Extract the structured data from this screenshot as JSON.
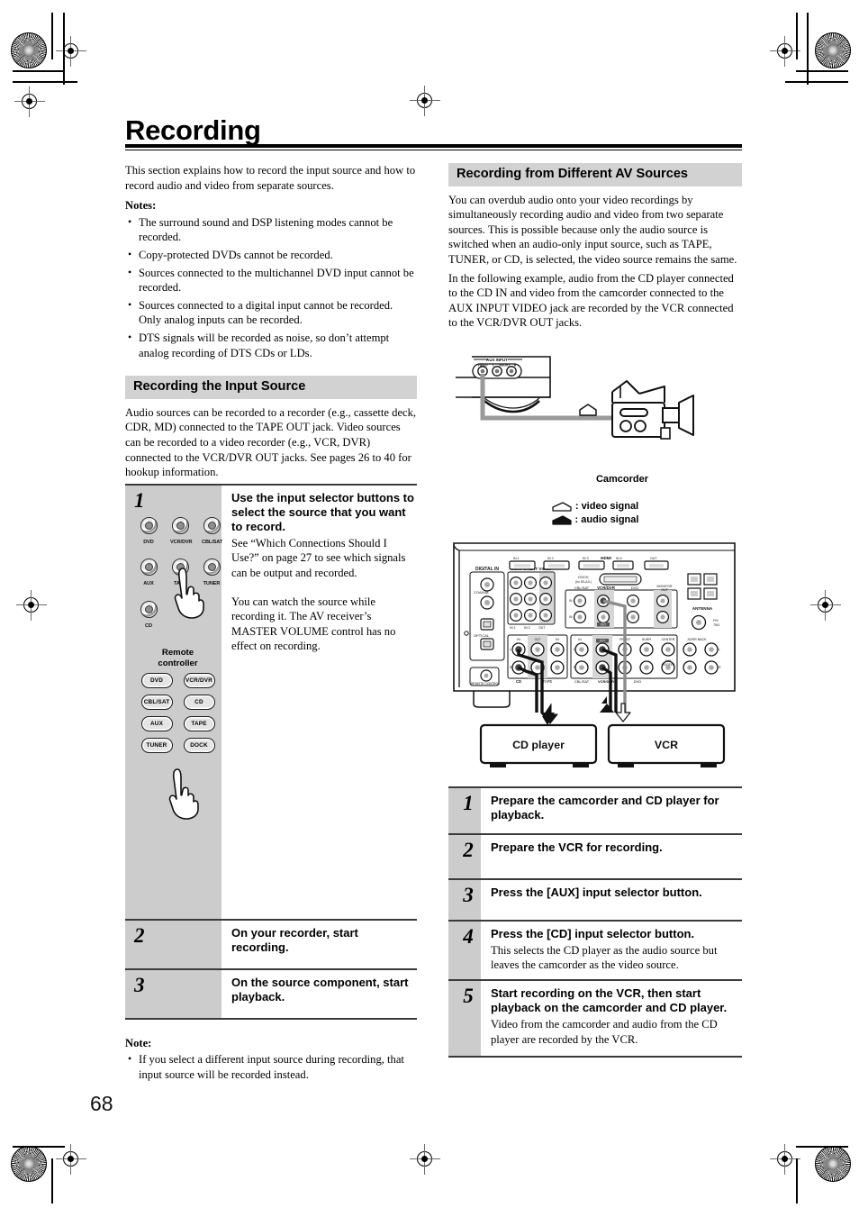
{
  "page": {
    "number": "68",
    "title": "Recording"
  },
  "intro": {
    "paragraph": "This section explains how to record the input source and how to record audio and video from separate sources.",
    "notes_label": "Notes:",
    "notes": [
      "The surround sound and DSP listening modes cannot be recorded.",
      "Copy-protected DVDs cannot be recorded.",
      "Sources connected to the multichannel DVD input cannot be recorded.",
      "Sources connected to a digital input cannot be recorded. Only analog inputs can be recorded.",
      "DTS signals will be recorded as noise, so don’t attempt analog recording of DTS CDs or LDs."
    ]
  },
  "section_input_source": {
    "heading": "Recording the Input Source",
    "paragraph": "Audio sources can be recorded to a recorder (e.g., cassette deck, CDR, MD) connected to the TAPE OUT jack. Video sources can be recorded to a video recorder (e.g., VCR, DVR) connected to the VCR/DVR OUT jacks. See pages 26 to 40 for hookup information.",
    "steps": [
      {
        "number": "1",
        "title": "Use the input selector buttons to select the source that you want to record.",
        "body1": "See “Which Connections Should I Use?” on page 27 to see which signals can be output and recorded.",
        "body2": "You can watch the source while recording it. The AV receiver’s MASTER VOLUME control has no effect on recording."
      },
      {
        "number": "2",
        "title": "On your recorder, start recording."
      },
      {
        "number": "3",
        "title": "On the source component, start playback."
      }
    ],
    "note_label": "Note:",
    "notes": [
      "If you select a different input source during recording, that input source will be recorded instead."
    ]
  },
  "illustration_front_panel": {
    "selector_buttons": [
      [
        "DVD",
        "VCR/DVR",
        "CBL/SAT"
      ],
      [
        "AUX",
        "TAPE",
        "TUNER"
      ],
      [
        "CD"
      ]
    ],
    "remote_label_line1": "Remote",
    "remote_label_line2": "controller",
    "remote_buttons": [
      [
        "DVD",
        "VCR/DVR"
      ],
      [
        "CBL/SAT",
        "CD"
      ],
      [
        "AUX",
        "TAPE"
      ],
      [
        "TUNER",
        "DOCK"
      ]
    ]
  },
  "section_av_sources": {
    "heading": "Recording from Different AV Sources",
    "paragraph1": "You can overdub audio onto your video recordings by simultaneously recording audio and video from two separate sources. This is possible because only the audio source is switched when an audio-only input source, such as TAPE, TUNER, or CD, is selected, the video source remains the same.",
    "paragraph2": "In the following example, audio from the CD player connected to the CD IN and video from the camcorder connected to the AUX INPUT VIDEO jack are recorded by the VCR connected to the VCR/DVR OUT jacks.",
    "steps": [
      {
        "number": "1",
        "title": "Prepare the camcorder and CD player for playback.",
        "body": ""
      },
      {
        "number": "2",
        "title": "Prepare the VCR for recording.",
        "body": ""
      },
      {
        "number": "3",
        "title": "Press the [AUX] input selector button.",
        "body": ""
      },
      {
        "number": "4",
        "title": "Press the [CD] input selector button.",
        "body": "This selects the CD player as the audio source but leaves the camcorder as the video source."
      },
      {
        "number": "5",
        "title": "Start recording on the VCR, then start playback on the camcorder and CD player.",
        "body": "Video from the camcorder and audio from the CD player are recorded by the VCR."
      }
    ]
  },
  "diagram_camcorder": {
    "aux_input_label": "AUX INPUT",
    "jack_labels": [
      "VIDEO",
      "L",
      "AUDIO",
      "R"
    ],
    "camcorder_caption": "Camcorder",
    "legend_video": ": video signal",
    "legend_audio": ": audio signal"
  },
  "diagram_rear_panel": {
    "labels": {
      "digital_in": "DIGITAL IN",
      "coaxial": "COAXIAL",
      "optical": "OPTICAL",
      "component_video": "COMPONENT VIDEO",
      "hdmi": "HDMI",
      "dock": "DOCK",
      "monitor_out": "MONITOR OUT",
      "antenna": "ANTENNA",
      "fm": "FM 75Ω",
      "remote_control": "REMOTE CONTROL",
      "cd": "CD",
      "tape": "TAPE",
      "cbl_sat": "CBL/SAT",
      "vcr_dvr": "VCR/DVR",
      "dvd": "DVD",
      "front": "FRONT",
      "center": "CENTER",
      "surr": "SURR",
      "surr_back": "SURR BACK",
      "in": "IN",
      "out": "OUT",
      "l": "L",
      "r": "R"
    },
    "devices": {
      "cd_player": "CD player",
      "vcr": "VCR"
    }
  },
  "colors": {
    "heading_bg": "#d2d2d2",
    "step_num_bg": "#cccccc",
    "rule": "#3a3a3a",
    "text": "#000000"
  }
}
